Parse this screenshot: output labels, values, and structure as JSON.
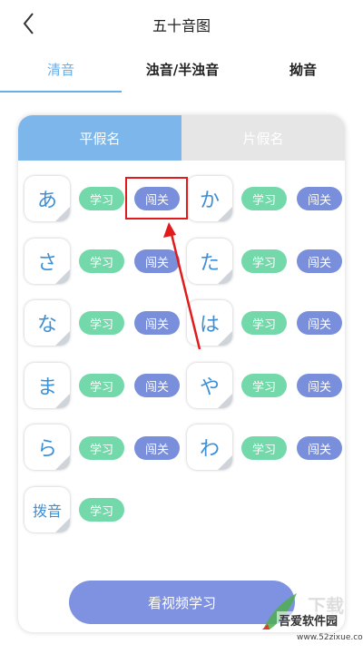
{
  "header": {
    "title": "五十音图",
    "back_icon": "chevron-left-icon"
  },
  "tabs": [
    {
      "label": "清音",
      "active": true
    },
    {
      "label": "浊音/半浊音",
      "active": false
    },
    {
      "label": "拗音",
      "active": false
    }
  ],
  "segment": {
    "active_label": "平假名",
    "inactive_label": "片假名"
  },
  "buttons": {
    "learn": "学习",
    "pass": "闯关"
  },
  "rows": [
    {
      "left": "あ",
      "right": "か"
    },
    {
      "left": "さ",
      "right": "た"
    },
    {
      "left": "な",
      "right": "は"
    },
    {
      "left": "ま",
      "right": "や"
    },
    {
      "left": "ら",
      "right": "わ"
    },
    {
      "left": "拨音"
    }
  ],
  "video_button": "看视频学习",
  "watermark": {
    "faint": "下载",
    "name": "吾爱软件园",
    "url": "www.52zixue.com"
  },
  "colors": {
    "accent": "#6aaee6",
    "learn": "#74d9aa",
    "pass": "#7a8fdc",
    "annotation": "#e11b1b"
  }
}
